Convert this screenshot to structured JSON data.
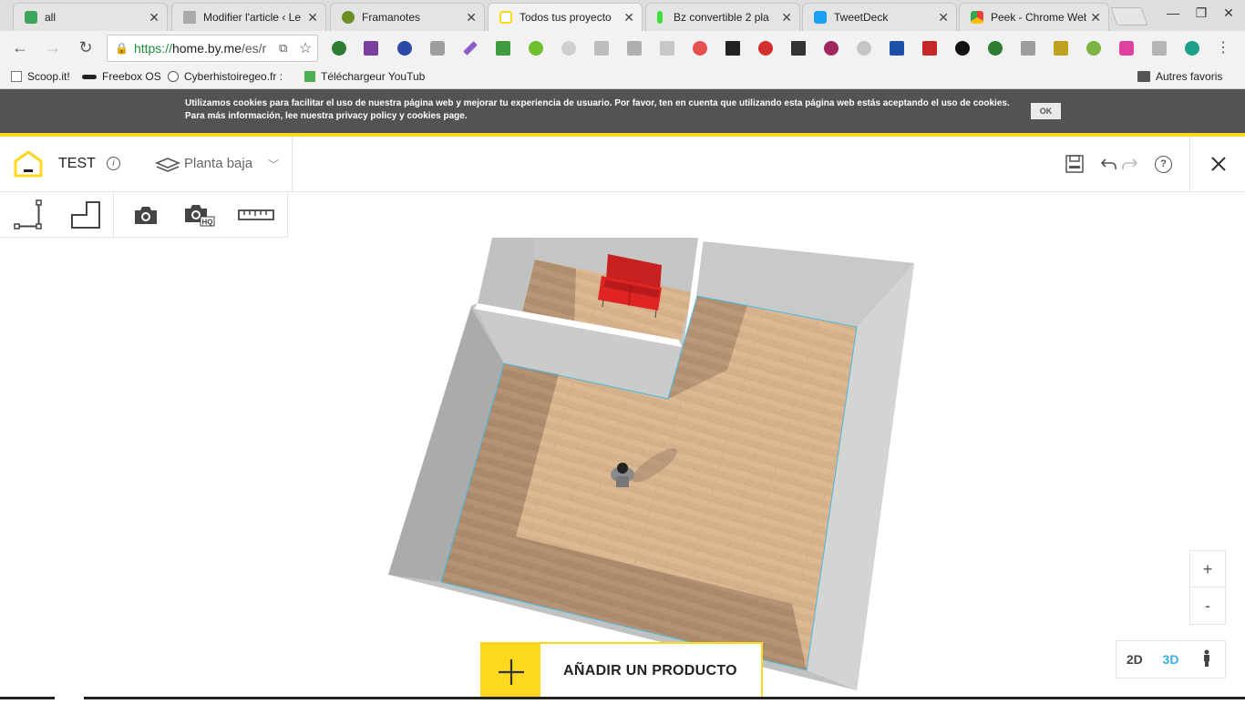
{
  "tabs": [
    {
      "title": "all",
      "fav_color": "#3ba55c",
      "active": false
    },
    {
      "title": "Modifier l'article ‹ Le",
      "fav_color": "#888888",
      "active": false
    },
    {
      "title": "Framanotes",
      "fav_color": "#6b8e23",
      "active": false
    },
    {
      "title": "Todos tus proyecto",
      "fav_color": "#fcd81f",
      "active": true
    },
    {
      "title": "Bz convertible 2 pla",
      "fav_color": "#3ee03e",
      "active": false
    },
    {
      "title": "TweetDeck",
      "fav_color": "#1da1f2",
      "active": false
    },
    {
      "title": "Peek - Chrome Web",
      "fav_color": "#e94235",
      "active": false
    }
  ],
  "browser": {
    "url_scheme": "https://",
    "url_host": "home.by.me",
    "url_path": "/es/r"
  },
  "bookmarks": [
    "Scoop.it!",
    "Freebox OS",
    "Cyberhistoiregeo.fr : ",
    "Téléchargeur YouTub",
    "Autres favoris"
  ],
  "cookie_bar": {
    "text": "Utilizamos cookies para facilitar el uso de nuestra página web y mejorar tu experiencia de usuario. Por favor, ten en cuenta que utilizando esta página web estás aceptando el uso de cookies. Para más información, lee nuestra privacy policy y cookies page.",
    "ok_label": "OK"
  },
  "header": {
    "project_name": "TEST",
    "info_label": "i",
    "floor_label": "Planta baja",
    "help_label": "?"
  },
  "tools": [
    "draw-wall-icon",
    "draw-room-icon",
    "camera-icon",
    "camera-hq-icon",
    "ruler-icon"
  ],
  "zoom": {
    "in_label": "+",
    "out_label": "-"
  },
  "views": {
    "v2d": "2D",
    "v3d": "3D",
    "active": "3D"
  },
  "add_product": {
    "label": "AÑADIR UN PRODUCTO"
  },
  "colors": {
    "accent": "#fcd81f",
    "active_view": "#3ab0e0",
    "floor": "#d8b28c",
    "wall": "#b9bcba"
  }
}
